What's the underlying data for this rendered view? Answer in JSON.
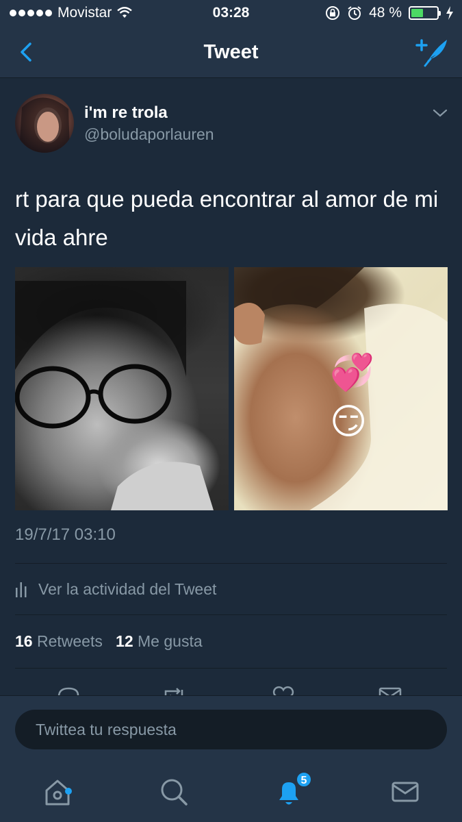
{
  "status_bar": {
    "carrier": "Movistar",
    "time": "03:28",
    "battery_percent": "48 %",
    "battery_level": 0.48,
    "icons": [
      "signal-dots",
      "wifi-icon",
      "orientation-lock-icon",
      "alarm-icon",
      "battery-icon",
      "charging-bolt-icon"
    ]
  },
  "nav": {
    "title": "Tweet",
    "back_icon": "chevron-left-icon",
    "compose_icon": "compose-tweet-icon"
  },
  "tweet": {
    "author": {
      "display_name": "i'm re trola",
      "handle": "@boludaporlauren"
    },
    "text": "rt para que pueda encontrar al amor de mi vida ahre",
    "media": [
      {
        "description_icon": "photo"
      },
      {
        "description_icon": "photo",
        "emojis": [
          "💞",
          "😏"
        ]
      }
    ],
    "timestamp": "19/7/17 03:10",
    "activity_label": "Ver la actividad del Tweet",
    "retweets_count": "16",
    "retweets_label": "Retweets",
    "likes_count": "12",
    "likes_label": "Me gusta"
  },
  "reply": {
    "placeholder": "Twittea tu respuesta"
  },
  "tab_bar": {
    "items": [
      "home-icon",
      "search-icon",
      "notifications-icon",
      "messages-icon"
    ],
    "notifications_badge": "5",
    "accent_color": "#1da1f2"
  },
  "colors": {
    "background": "#1c2a3a",
    "bar": "#243447",
    "muted_text": "#8899a6",
    "accent": "#1da1f2"
  }
}
